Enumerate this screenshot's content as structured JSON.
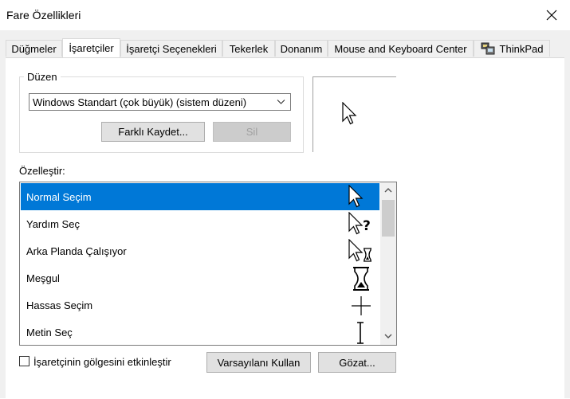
{
  "window": {
    "title": "Fare Özellikleri"
  },
  "tabs": [
    {
      "label": "Düğmeler"
    },
    {
      "label": "İşaretçiler",
      "active": true
    },
    {
      "label": "İşaretçi Seçenekleri"
    },
    {
      "label": "Tekerlek"
    },
    {
      "label": "Donanım"
    },
    {
      "label": "Mouse and Keyboard Center"
    },
    {
      "label": "ThinkPad",
      "icon": "thinkpad-icon"
    }
  ],
  "scheme": {
    "legend": "Düzen",
    "selected": "Windows Standart (çok büyük) (sistem düzeni)",
    "save_as_label": "Farklı Kaydet...",
    "delete_label": "Sil"
  },
  "customize": {
    "label": "Özelleştir:",
    "items": [
      {
        "label": "Normal Seçim",
        "icon": "arrow-cursor-icon",
        "selected": true
      },
      {
        "label": "Yardım Seç",
        "icon": "help-cursor-icon"
      },
      {
        "label": "Arka Planda Çalışıyor",
        "icon": "working-cursor-icon"
      },
      {
        "label": "Meşgul",
        "icon": "hourglass-cursor-icon"
      },
      {
        "label": "Hassas Seçim",
        "icon": "crosshair-cursor-icon"
      },
      {
        "label": "Metin Seç",
        "icon": "text-cursor-icon"
      }
    ]
  },
  "shadow": {
    "label": "İşaretçinin gölgesini etkinleştir",
    "checked": false
  },
  "buttons": {
    "use_default": "Varsayılanı Kullan",
    "browse": "Gözat..."
  },
  "colors": {
    "selection": "#0078d7",
    "background": "#f0f0f0"
  }
}
